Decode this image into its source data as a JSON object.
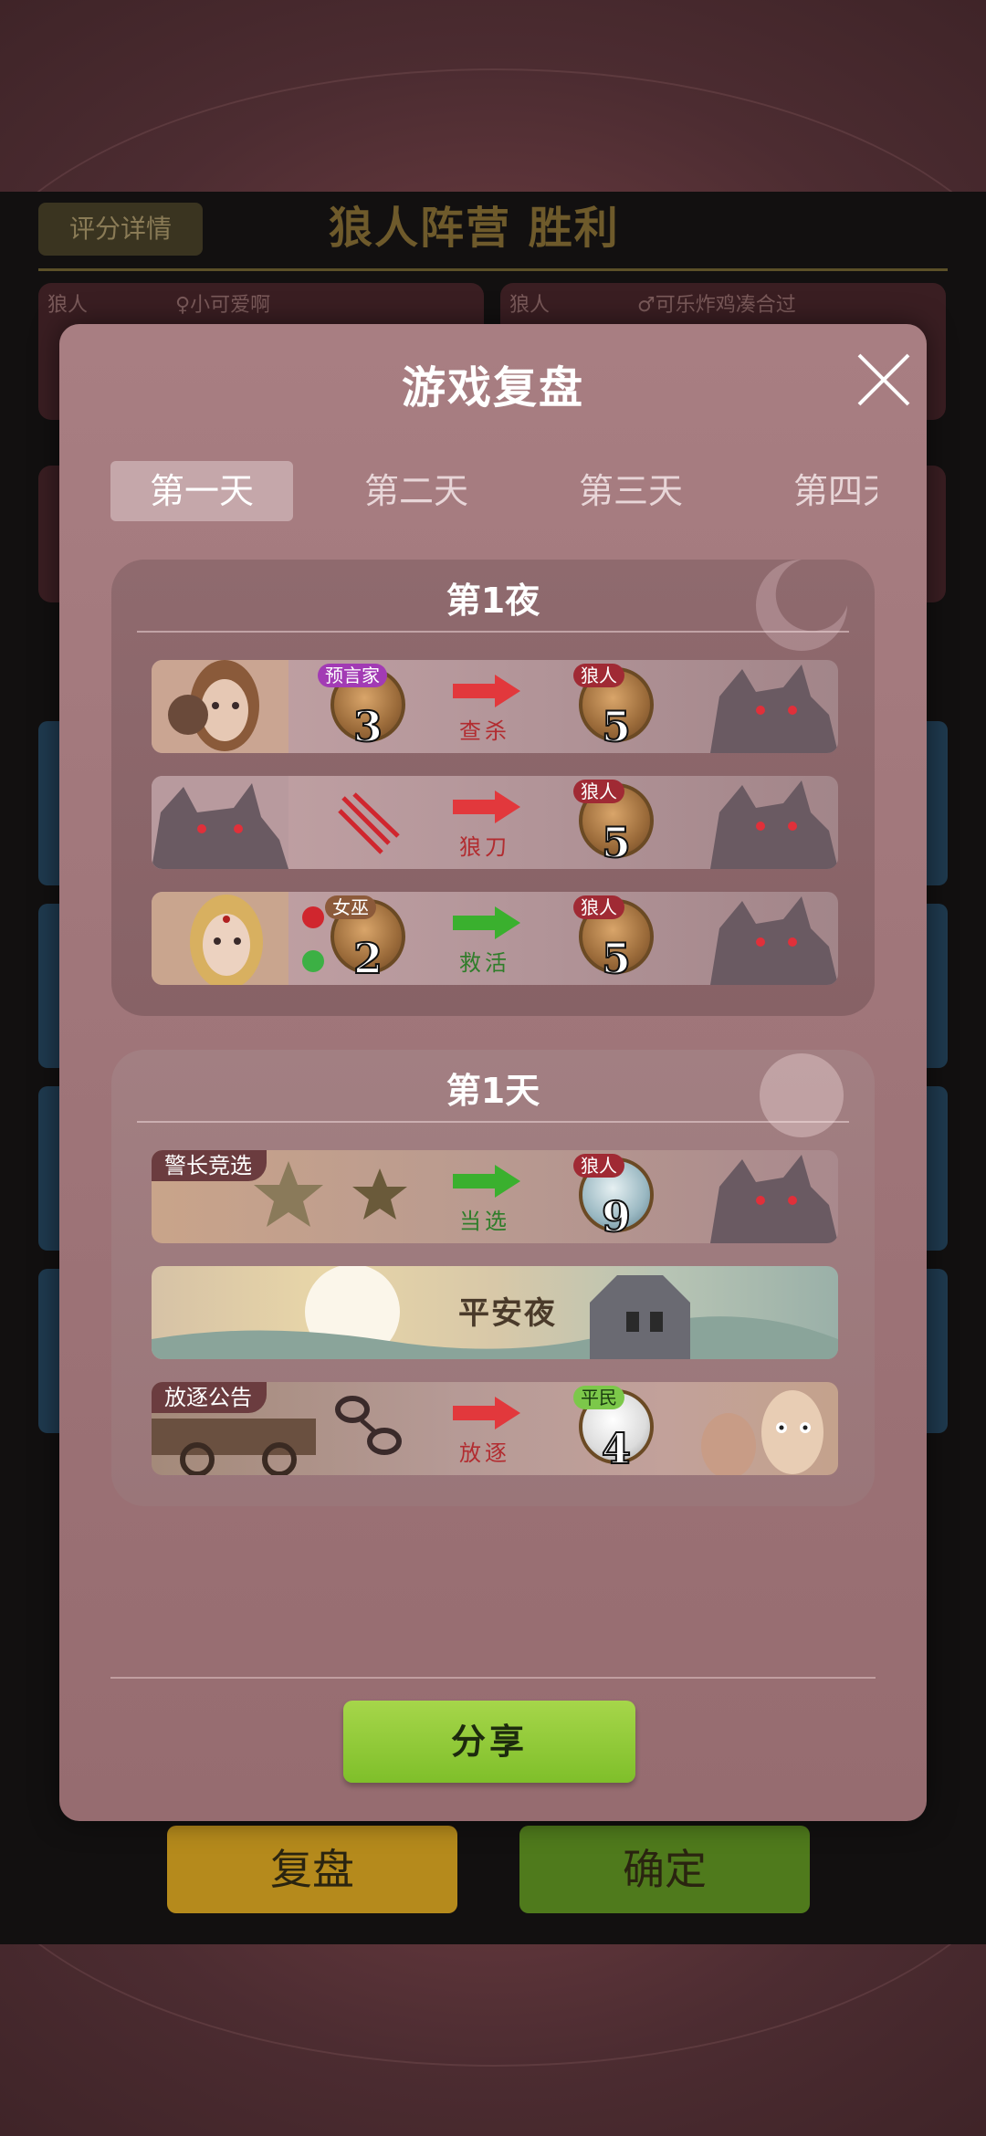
{
  "background": {
    "rating_button": "评分详情",
    "result_title": "狼人阵营  胜利",
    "player_cards": [
      {
        "tag": "狼人",
        "name": "♀小可爱啊"
      },
      {
        "tag": "狼人",
        "name": "♂可乐炸鸡凑合过"
      }
    ],
    "review_button": "复盘",
    "confirm_button": "确定"
  },
  "modal": {
    "title": "游戏复盘",
    "close_icon": "close-icon",
    "tabs": [
      {
        "label": "第一天",
        "active": true
      },
      {
        "label": "第二天",
        "active": false
      },
      {
        "label": "第三天",
        "active": false
      },
      {
        "label": "第四天",
        "active": false
      }
    ],
    "night": {
      "title": "第1夜",
      "events": [
        {
          "actor_role": "预言家",
          "actor_number": "3",
          "action": "查杀",
          "action_color": "red",
          "target_role": "狼人",
          "target_number": "5"
        },
        {
          "actor_role": "",
          "actor_number": "",
          "action": "狼刀",
          "action_color": "red",
          "target_role": "狼人",
          "target_number": "5"
        },
        {
          "actor_role": "女巫",
          "actor_number": "2",
          "action": "救活",
          "action_color": "green",
          "target_role": "狼人",
          "target_number": "5"
        }
      ]
    },
    "day": {
      "title": "第1天",
      "sheriff": {
        "tag": "警长竞选",
        "action": "当选",
        "target_role": "狼人",
        "target_number": "9"
      },
      "peace": {
        "text": "平安夜"
      },
      "exile": {
        "tag": "放逐公告",
        "action": "放逐",
        "target_role": "平民",
        "target_number": "4"
      }
    },
    "share_button": "分享"
  },
  "colors": {
    "modal_bg": "#a87e82",
    "wolf_badge": "#a02a34",
    "seer_badge": "#a23bb4",
    "civ_badge": "#7cc84a",
    "arrow_red": "#e2383c",
    "arrow_green": "#3ab02e",
    "share_green": "#8bc934"
  }
}
